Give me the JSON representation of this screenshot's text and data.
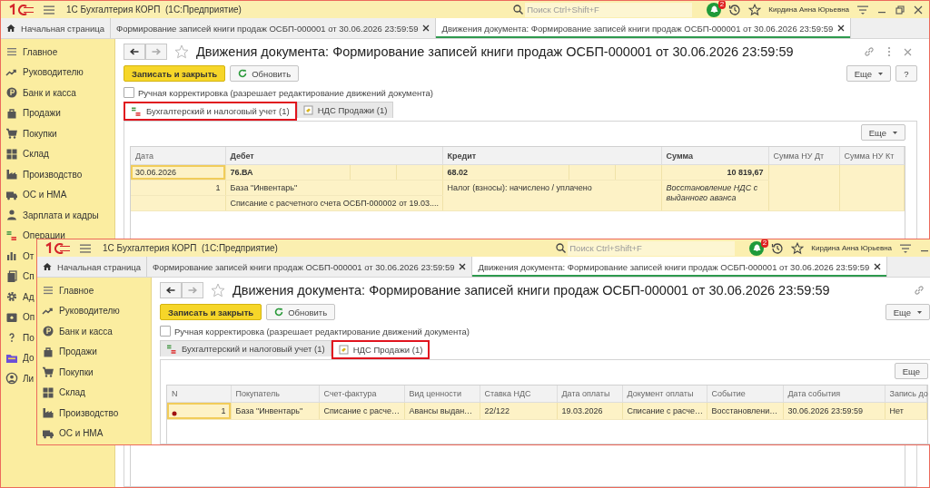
{
  "windows": [
    {
      "kind": "back",
      "cut_right": false,
      "app_title": "1С Бухгалтерия КОРП  (1С:Предприятие)",
      "search": {
        "placeholder": "Поиск Ctrl+Shift+F"
      },
      "notifications": "2",
      "user": "Кирдина Анна Юрьевна",
      "home_tab": "Начальная страница",
      "tabs": [
        {
          "label": "Формирование записей книги продаж ОСБП-000001 от 30.06.2026 23:59:59",
          "selected": false
        },
        {
          "label": "Движения документа: Формирование записей книги продаж ОСБП-000001 от 30.06.2026 23:59:59",
          "selected": true
        }
      ],
      "sidebar": {
        "items": [
          {
            "label": "Главное"
          },
          {
            "label": "Руководителю"
          },
          {
            "label": "Банк и касса"
          },
          {
            "label": "Продажи"
          },
          {
            "label": "Покупки"
          },
          {
            "label": "Склад"
          },
          {
            "label": "Производство"
          },
          {
            "label": "ОС и НМА"
          },
          {
            "label": "Зарплата и кадры"
          },
          {
            "label": "Операции"
          },
          {
            "label": "От"
          },
          {
            "label": "Сп"
          },
          {
            "label": "Ад"
          },
          {
            "label": "Оп"
          },
          {
            "label": "По"
          },
          {
            "label": "До"
          },
          {
            "label": "Ли"
          }
        ]
      },
      "form": {
        "title": "Движения документа: Формирование записей книги продаж ОСБП-000001 от 30.06.2026 23:59:59",
        "save_button": "Записать и закрыть",
        "refresh_button": "Обновить",
        "more_button": "Еще",
        "help_button": "?",
        "checkbox": {
          "label": "Ручная корректировка (разрешает редактирование движений документа)",
          "checked": false
        },
        "tabs": [
          {
            "label": "Бухгалтерский и налоговый учет (1)",
            "selected": true,
            "outlined": true
          },
          {
            "label": "НДС Продажи (1)",
            "selected": false,
            "outlined": false
          }
        ],
        "table_more_button": "Еще",
        "table": {
          "kind": "entries",
          "columns": [
            {
              "label": "Дата",
              "bold": false
            },
            {
              "label": "Дебет",
              "bold": true
            },
            {
              "label": "Кредит",
              "bold": true
            },
            {
              "label": "Сумма",
              "bold": true
            },
            {
              "label": "Сумма НУ Дт",
              "bold": false
            },
            {
              "label": "Сумма НУ Кт",
              "bold": false
            }
          ],
          "rows": [
            {
              "selected": true,
              "date": "30.06.2026",
              "number": "1",
              "debit": [
                "76.ВА",
                "База \"Инвентарь\"",
                "Списание с расчетного счета ОСБП-000002 от 19.03...."
              ],
              "credit": [
                "68.02",
                "Налог (взносы): начислено / уплачено"
              ],
              "amount": "10 819,67",
              "content": "Восстановление НДС с выданного аванса"
            }
          ]
        }
      }
    },
    {
      "kind": "front",
      "cut_right": true,
      "app_title": "1С Бухгалтерия КОРП  (1С:Предприятие)",
      "search": {
        "placeholder": "Поиск Ctrl+Shift+F"
      },
      "notifications": "2",
      "user": "Кирдина Анна Юрьевна",
      "home_tab": "Начальная страница",
      "tabs": [
        {
          "label": "Формирование записей книги продаж ОСБП-000001 от 30.06.2026 23:59:59",
          "selected": false
        },
        {
          "label": "Движения документа: Формирование записей книги продаж ОСБП-000001 от 30.06.2026 23:59:59",
          "selected": true
        }
      ],
      "sidebar": {
        "items": [
          {
            "label": "Главное"
          },
          {
            "label": "Руководителю"
          },
          {
            "label": "Банк и касса"
          },
          {
            "label": "Продажи"
          },
          {
            "label": "Покупки"
          },
          {
            "label": "Склад"
          },
          {
            "label": "Производство"
          },
          {
            "label": "ОС и НМА"
          }
        ]
      },
      "form": {
        "title": "Движения документа: Формирование записей книги продаж ОСБП-000001 от 30.06.2026 23:59:59",
        "save_button": "Записать и закрыть",
        "refresh_button": "Обновить",
        "more_button": "Еще",
        "checkbox": {
          "label": "Ручная корректировка (разрешает редактирование движений документа)",
          "checked": false
        },
        "tabs": [
          {
            "label": "Бухгалтерский и налоговый учет (1)",
            "selected": false,
            "outlined": false
          },
          {
            "label": "НДС Продажи (1)",
            "selected": true,
            "outlined": true
          }
        ],
        "table_more_button": "Еще",
        "table": {
          "kind": "list",
          "columns": [
            {
              "label": "N"
            },
            {
              "label": "Покупатель"
            },
            {
              "label": "Счет-фактура"
            },
            {
              "label": "Вид ценности"
            },
            {
              "label": "Ставка НДС"
            },
            {
              "label": "Дата оплаты"
            },
            {
              "label": "Документ оплаты"
            },
            {
              "label": "Событие"
            },
            {
              "label": "Дата события"
            },
            {
              "label": "Запись до"
            }
          ],
          "rows": [
            {
              "selected": true,
              "cells": [
                "1",
                "База \"Инвентарь\"",
                "Списание с расче…",
                "Авансы выдан…",
                "22/122",
                "19.03.2026",
                "Списание с расче…",
                "Восстановлени…",
                "30.06.2026 23:59:59",
                "Нет"
              ]
            }
          ]
        }
      }
    }
  ]
}
